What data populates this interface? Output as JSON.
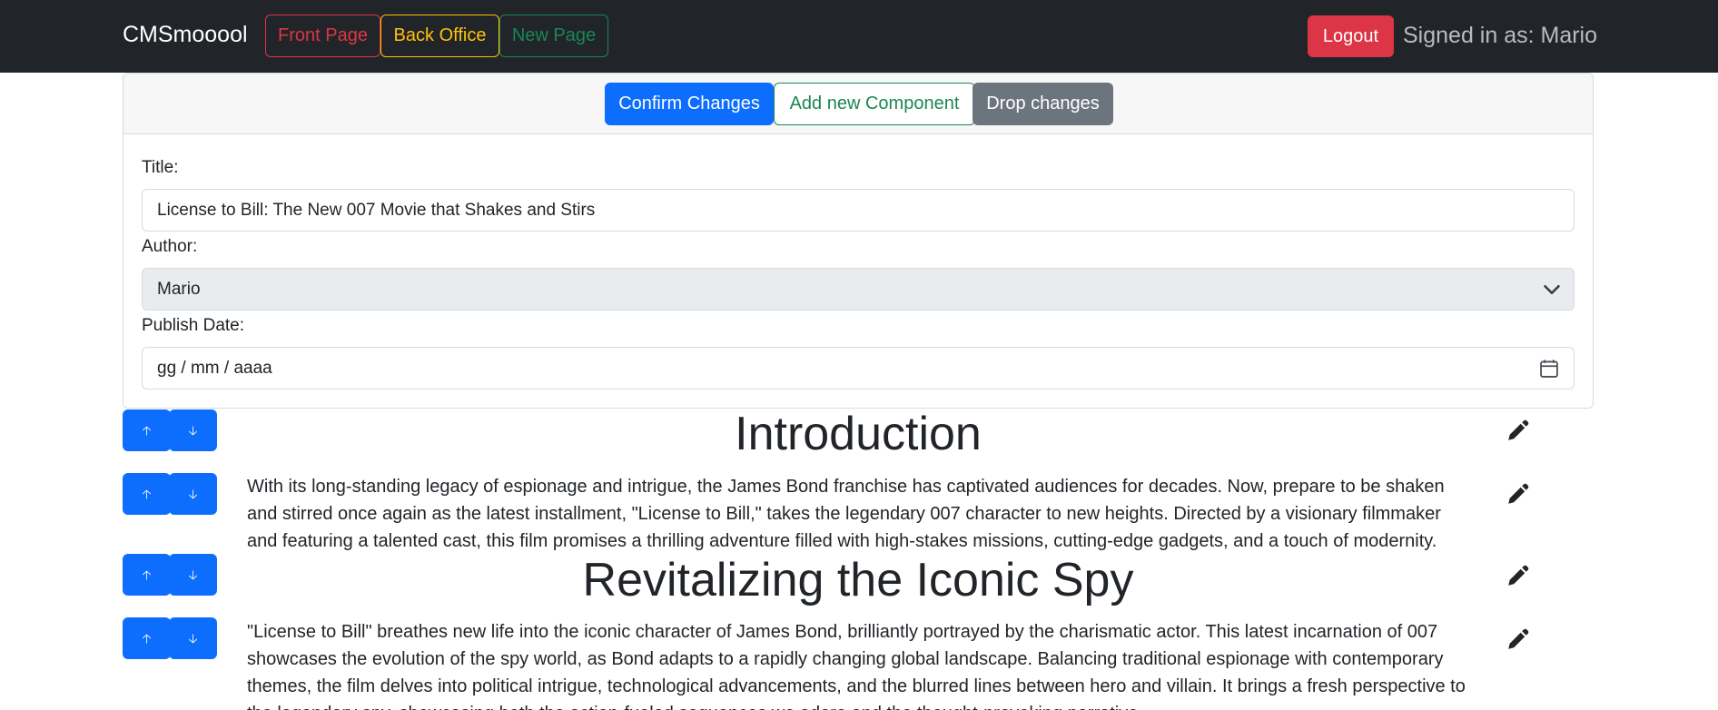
{
  "navbar": {
    "brand": "CMSmooool",
    "front_page": "Front Page",
    "back_office": "Back Office",
    "new_page": "New Page",
    "logout": "Logout",
    "signed_in": "Signed in as: Mario"
  },
  "toolbar": {
    "confirm": "Confirm Changes",
    "add": "Add new Component",
    "drop": "Drop changes"
  },
  "form": {
    "title_label": "Title:",
    "title_value": "License to Bill: The New 007 Movie that Shakes and Stirs",
    "author_label": "Author:",
    "author_value": "Mario",
    "date_label": "Publish Date:",
    "date_placeholder": "gg / mm / aaaa"
  },
  "components": [
    {
      "type": "header",
      "text": "Introduction"
    },
    {
      "type": "paragraph",
      "text": "With its long-standing legacy of espionage and intrigue, the James Bond franchise has captivated audiences for decades. Now, prepare to be shaken and stirred once again as the latest installment, \"License to Bill,\" takes the legendary 007 character to new heights. Directed by a visionary filmmaker and featuring a talented cast, this film promises a thrilling adventure filled with high-stakes missions, cutting-edge gadgets, and a touch of modernity."
    },
    {
      "type": "header",
      "text": "Revitalizing the Iconic Spy"
    },
    {
      "type": "paragraph",
      "text": "\"License to Bill\" breathes new life into the iconic character of James Bond, brilliantly portrayed by the charismatic actor. This latest incarnation of 007 showcases the evolution of the spy world, as Bond adapts to a rapidly changing global landscape. Balancing traditional espionage with contemporary themes, the film delves into political intrigue, technological advancements, and the blurred lines between hero and villain. It brings a fresh perspective to the legendary spy, showcasing both the action-fueled sequences we adore and the thought-provoking narrative."
    }
  ],
  "icons": {
    "move_up": "arrow-up-icon",
    "move_down": "arrow-down-icon",
    "edit": "pencil-icon",
    "select": "chevron-down-icon",
    "date": "calendar-icon"
  },
  "colors": {
    "navbar_bg": "#212529",
    "primary": "#0d6efd",
    "danger": "#dc3545",
    "warning": "#ffc107",
    "success": "#198754",
    "secondary": "#6c757d"
  }
}
